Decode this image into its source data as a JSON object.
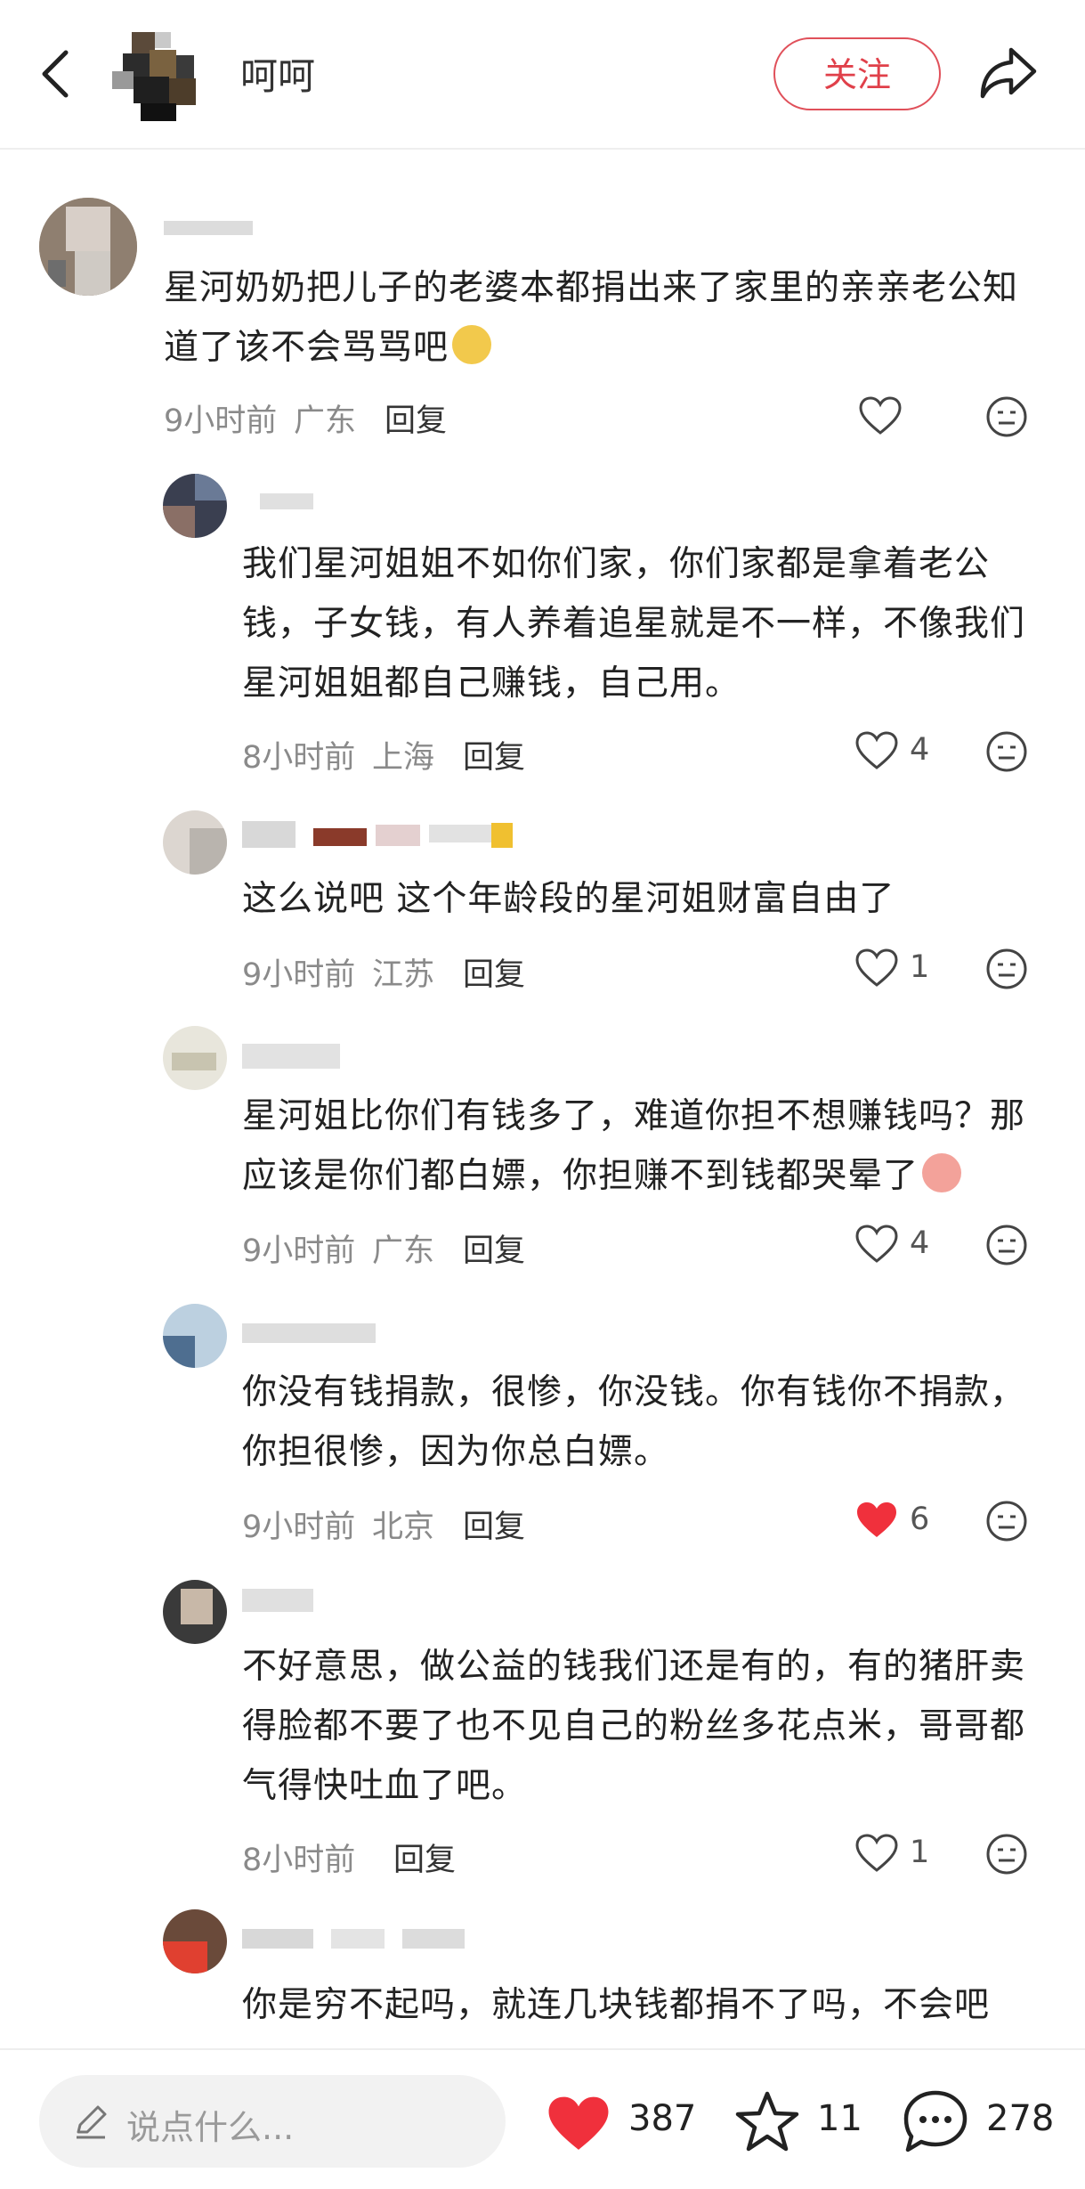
{
  "header": {
    "username": "呵呵",
    "follow_label": "关注"
  },
  "comments": [
    {
      "text": "星河奶奶把儿子的老婆本都捐出来了家里的亲亲老公知道了该不会骂骂吧",
      "time": "9小时前",
      "location": "广东",
      "reply_label": "回复",
      "likes": ""
    },
    {
      "text": "我们星河姐姐不如你们家，你们家都是拿着老公钱，子女钱，有人养着追星就是不一样，不像我们星河姐姐都自己赚钱，自己用。",
      "time": "8小时前",
      "location": "上海",
      "reply_label": "回复",
      "likes": "4"
    },
    {
      "text": "这么说吧 这个年龄段的星河姐财富自由了",
      "time": "9小时前",
      "location": "江苏",
      "reply_label": "回复",
      "likes": "1"
    },
    {
      "text": "星河姐比你们有钱多了，难道你担不想赚钱吗？那应该是你们都白嫖，你担赚不到钱都哭晕了",
      "time": "9小时前",
      "location": "广东",
      "reply_label": "回复",
      "likes": "4"
    },
    {
      "text": "你没有钱捐款，很惨，你没钱。你有钱你不捐款，你担很惨，因为你总白嫖。",
      "time": "9小时前",
      "location": "北京",
      "reply_label": "回复",
      "likes": "6"
    },
    {
      "text": "不好意思，做公益的钱我们还是有的，有的猪肝卖得脸都不要了也不见自己的粉丝多花点米，哥哥都气得快吐血了吧。",
      "time": "8小时前",
      "location": "",
      "reply_label": "回复",
      "likes": "1"
    },
    {
      "text": "你是穷不起吗，就连几块钱都捐不了吗，不会吧"
    }
  ],
  "bottom": {
    "placeholder": "说点什么...",
    "like_count": "387",
    "star_count": "11",
    "comment_count": "278"
  },
  "colors": {
    "accent": "#e0404a",
    "liked": "#f0303c",
    "meta_gray": "#8a8a8a"
  }
}
